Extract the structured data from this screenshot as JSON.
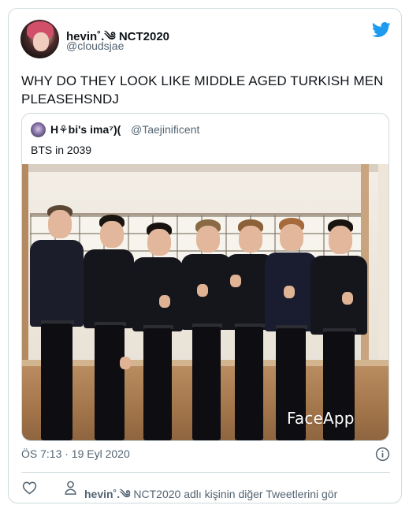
{
  "tweet": {
    "author": {
      "display_name": "hevin˚.༄ NCT2020",
      "handle": "@cloudsjae"
    },
    "text": "WHY DO THEY LOOK LIKE MIDDLE AGED TURKISH MEN PLEASEHSNDJ",
    "timestamp": "ÖS 7:13 · 19 Eyl 2020",
    "icons": {
      "brand": "twitter-bird-icon",
      "info": "info-icon",
      "like": "heart-icon",
      "profile": "person-icon"
    }
  },
  "quoted_tweet": {
    "author": {
      "display_name": "H⚘bi's ima⁷)(",
      "handle": "@Taejinificent"
    },
    "text": "BTS in 2039",
    "image_watermark": "FaceApp"
  },
  "footer": {
    "more_tweets_name": "hevin˚.༄",
    "more_tweets_text": " NCT2020 adlı kişinin diğer Tweetlerini gör"
  },
  "colors": {
    "brand_blue": "#1d9bf0",
    "secondary_text": "#536471",
    "border": "#cfd9de"
  }
}
